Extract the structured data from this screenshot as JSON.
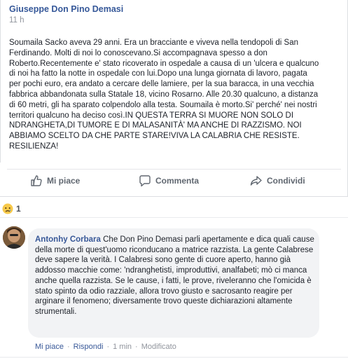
{
  "post": {
    "author": "Giuseppe Don Pino Demasi",
    "time": "11 h",
    "text": "Soumaila Sacko aveva 29 anni. Era un bracciante e viveva nella tendopoli di San\nFerdinando. Molti di noi lo conoscevano.Si accompagnava spesso a don\nRoberto.Recentemente e' stato ricoverato in ospedale a causa di un 'ulcera e qualcuno\ndi noi ha fatto la notte in ospedale con lui.Dopo una lunga giornata di lavoro, pagata\nper pochi euro, era andato a cercare delle lamiere, per la sua baracca, in una vecchia\nfabbrica abbandonata sulla Statale 18, vicino Rosarno. Alle 20.30 qualcuno, a distanza\ndi 60 metri, gli ha sparato colpendolo alla testa. Soumaila è morto.Si' perché' nei nostri\nterritori qualcuno ha deciso così.IN QUESTA TERRA SI MUORE NON SOLO DI\nNDRANGHETA,DI TUMORE E DI MALASANITÀ' MA ANCHE DI RAZZISMO. NOI\nABBIAMO SCELTO DA CHE PARTE STARE!VIVA LA CALABRIA CHE RESISTE.\nRESILIENZA!"
  },
  "actions": {
    "like": "Mi piace",
    "comment": "Commenta",
    "share": "Condividi"
  },
  "reactions": {
    "count": "1",
    "icon": "sad-face-icon"
  },
  "comment": {
    "author": "Antonhy Corbara",
    "text": "Che Don Pino Demasi parli apertamente e dica quali cause della morte di quest'uomo riconducano a matrice razzista. La gente Calabrese deve sapere la verità. I Calabresi sono gente di cuore aperto, hanno già addosso macchie come: 'ndranghetisti, improduttivi, analfabeti; mò ci manca anche quella razzista. Se le cause, i fatti, le prove, riveleranno che l'omicida è stato spinto da odio razziale, allora trovo giusto e sacrosanto reagire per arginare il fenomeno; diversamente trovo queste dichiarazioni altamente strumentali.",
    "like": "Mi piace",
    "reply": "Rispondi",
    "time": "1 min",
    "edited": "Modificato",
    "separator": "·"
  },
  "colors": {
    "link": "#385898",
    "meta": "#90949c",
    "bubble": "#f2f3f5"
  }
}
